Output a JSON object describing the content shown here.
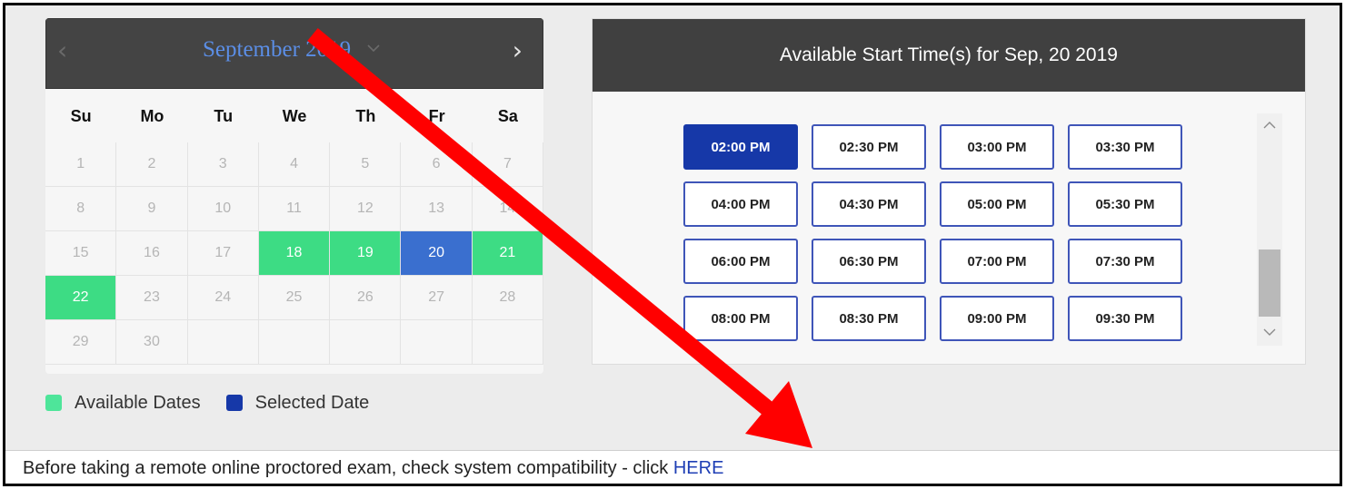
{
  "calendar": {
    "month_label": "September 2019",
    "prev_icon": "‹",
    "next_icon": "›",
    "weekdays": [
      "Su",
      "Mo",
      "Tu",
      "We",
      "Th",
      "Fr",
      "Sa"
    ],
    "days": [
      {
        "label": "1",
        "state": "unavailable"
      },
      {
        "label": "2",
        "state": "unavailable"
      },
      {
        "label": "3",
        "state": "unavailable"
      },
      {
        "label": "4",
        "state": "unavailable"
      },
      {
        "label": "5",
        "state": "unavailable"
      },
      {
        "label": "6",
        "state": "unavailable"
      },
      {
        "label": "7",
        "state": "unavailable"
      },
      {
        "label": "8",
        "state": "unavailable"
      },
      {
        "label": "9",
        "state": "unavailable"
      },
      {
        "label": "10",
        "state": "unavailable"
      },
      {
        "label": "11",
        "state": "unavailable"
      },
      {
        "label": "12",
        "state": "unavailable"
      },
      {
        "label": "13",
        "state": "unavailable"
      },
      {
        "label": "14",
        "state": "unavailable"
      },
      {
        "label": "15",
        "state": "unavailable"
      },
      {
        "label": "16",
        "state": "unavailable"
      },
      {
        "label": "17",
        "state": "unavailable"
      },
      {
        "label": "18",
        "state": "available"
      },
      {
        "label": "19",
        "state": "available"
      },
      {
        "label": "20",
        "state": "selected"
      },
      {
        "label": "21",
        "state": "available"
      },
      {
        "label": "22",
        "state": "available"
      },
      {
        "label": "23",
        "state": "unavailable"
      },
      {
        "label": "24",
        "state": "unavailable"
      },
      {
        "label": "25",
        "state": "unavailable"
      },
      {
        "label": "26",
        "state": "unavailable"
      },
      {
        "label": "27",
        "state": "unavailable"
      },
      {
        "label": "28",
        "state": "unavailable"
      },
      {
        "label": "29",
        "state": "unavailable"
      },
      {
        "label": "30",
        "state": "unavailable"
      }
    ]
  },
  "legend": {
    "available_label": "Available Dates",
    "selected_label": "Selected Date"
  },
  "times": {
    "header": "Available Start Time(s) for Sep, 20 2019",
    "slots": [
      {
        "label": "02:00 PM",
        "selected": true
      },
      {
        "label": "02:30 PM",
        "selected": false
      },
      {
        "label": "03:00 PM",
        "selected": false
      },
      {
        "label": "03:30 PM",
        "selected": false
      },
      {
        "label": "04:00 PM",
        "selected": false
      },
      {
        "label": "04:30 PM",
        "selected": false
      },
      {
        "label": "05:00 PM",
        "selected": false
      },
      {
        "label": "05:30 PM",
        "selected": false
      },
      {
        "label": "06:00 PM",
        "selected": false
      },
      {
        "label": "06:30 PM",
        "selected": false
      },
      {
        "label": "07:00 PM",
        "selected": false
      },
      {
        "label": "07:30 PM",
        "selected": false
      },
      {
        "label": "08:00 PM",
        "selected": false
      },
      {
        "label": "08:30 PM",
        "selected": false
      },
      {
        "label": "09:00 PM",
        "selected": false
      },
      {
        "label": "09:30 PM",
        "selected": false
      }
    ]
  },
  "footer": {
    "text": "Before taking a remote online proctored exam, check system compatibility - click ",
    "link_label": "HERE"
  },
  "colors": {
    "available": "#3ddc84",
    "selected_date": "#3a6fcf",
    "selected_slot": "#1638a8",
    "header_bg": "#404040",
    "month_title": "#5b8ee6",
    "link": "#1f3fb5",
    "annotation_arrow": "#ff0000"
  },
  "icons": {
    "prev": "chevron-left-icon",
    "next": "chevron-right-icon",
    "month_dropdown": "chevron-down-icon",
    "scroll_up": "chevron-up-icon",
    "scroll_down": "chevron-down-icon",
    "annotation": "red-arrow-icon"
  }
}
